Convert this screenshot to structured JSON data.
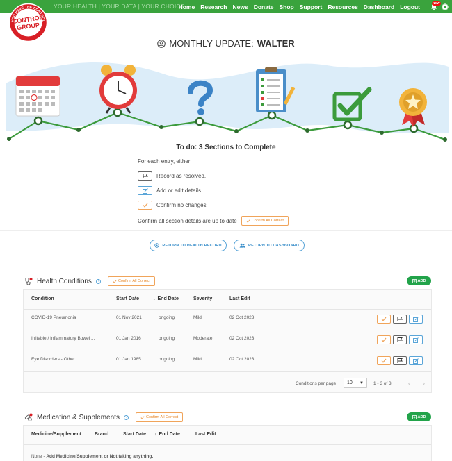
{
  "nav": {
    "tagline": "YOUR HEALTH | YOUR DATA | YOUR CHOICE",
    "items": [
      "Home",
      "Research",
      "News",
      "Donate",
      "Shop",
      "Support",
      "Resources",
      "Dashboard",
      "Logout"
    ],
    "new_badge": "NEW"
  },
  "logo": {
    "top_text": "YOU HAVE THE CONTROL",
    "name_line1": "CONTROL",
    "name_line2": "GROUP"
  },
  "header": {
    "title_prefix": "MONTHLY UPDATE:",
    "title_name": "WALTER"
  },
  "progress_icons": [
    "calendar-icon",
    "alarm-clock-icon",
    "question-mark-icon",
    "clipboard-checklist-icon",
    "checkbox-tick-icon",
    "medal-icon"
  ],
  "todo": {
    "title": "To do: 3 Sections to Complete",
    "instruction": "For each entry, either:",
    "options": [
      "Record as resolved.",
      "Add or edit details",
      "Confirm no changes"
    ],
    "confirm_all_text": "Confirm all section details are up to date",
    "confirm_all_button": "Confirm All Correct"
  },
  "buttons": {
    "return_health": "RETURN TO HEALTH RECORD",
    "return_dashboard": "RETURN TO DASHBOARD",
    "add": "ADD"
  },
  "health_conditions": {
    "title": "Health Conditions",
    "confirm_button": "Confirm All Correct",
    "columns": [
      "Condition",
      "Start Date",
      "End Date",
      "Severity",
      "Last Edit"
    ],
    "rows": [
      {
        "condition": "COVID-19 Pneumonia",
        "start": "01 Nov 2021",
        "end": "ongoing",
        "severity": "Mild",
        "last_edit": "02 Oct 2023"
      },
      {
        "condition": "Irritable / Inflammatory Bowel ...",
        "start": "01 Jan 2016",
        "end": "ongoing",
        "severity": "Moderate",
        "last_edit": "02 Oct 2023"
      },
      {
        "condition": "Eye Disorders - Other",
        "start": "01 Jan 1985",
        "end": "ongoing",
        "severity": "Mild",
        "last_edit": "02 Oct 2023"
      }
    ],
    "per_page_label": "Conditions per page",
    "per_page_value": "10",
    "range": "1 - 3 of 3"
  },
  "medication": {
    "title": "Medication & Supplements",
    "confirm_button": "Confirm All Correct",
    "columns": [
      "Medicine/Supplement",
      "Brand",
      "Start Date",
      "End Date",
      "Last Edit"
    ],
    "empty_prefix": "None - ",
    "empty_link": "Add Medicine/Supplement or Not taking anything."
  },
  "colors": {
    "nav_green": "#3aa33d",
    "add_green": "#22a34a",
    "orange": "#f0a45a",
    "blue": "#5aa5d8",
    "sky": "#dcedf9"
  }
}
